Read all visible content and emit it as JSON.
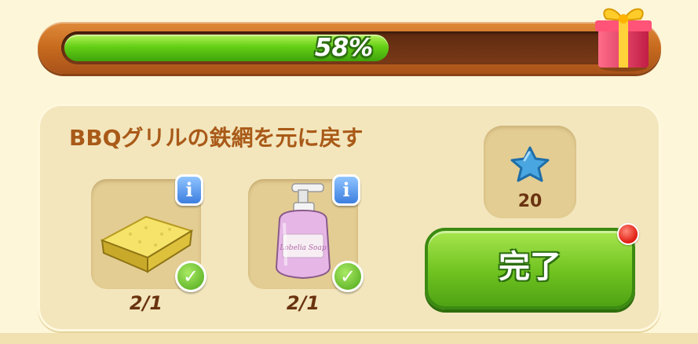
{
  "progress": {
    "percent": 58,
    "label": "58%"
  },
  "task": {
    "title": "BBQグリルの鉄網を元に戻す",
    "items": [
      {
        "name": "sponge",
        "count": "2/1",
        "icon": "sponge-icon",
        "completed": true
      },
      {
        "name": "soap-dispenser",
        "count": "2/1",
        "icon": "soap-bottle-icon",
        "completed": true,
        "bottle_label": "Lobelia Soap"
      }
    ],
    "reward": {
      "icon": "blue-star-icon",
      "amount": "20"
    },
    "complete_label": "完了"
  },
  "badges": {
    "info": "i",
    "check": "✓"
  },
  "colors": {
    "progress_fill": "#65cf16",
    "title": "#a95a18",
    "button": "#6fc21f",
    "notify": "#e0190f"
  }
}
